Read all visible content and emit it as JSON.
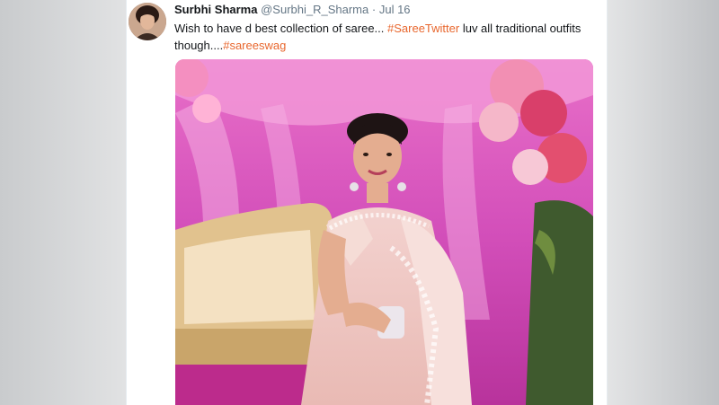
{
  "tweet": {
    "display_name": "Surbhi Sharma",
    "handle": "@Surbhi_R_Sharma",
    "separator": "·",
    "date": "Jul 16",
    "text_part1": "Wish to have d best collection of saree... ",
    "hashtag1": "#SareeTwitter",
    "text_part2": "  luv all traditional outfits though....",
    "hashtag2": "#sareeswag"
  },
  "colors": {
    "hashtag": "#e8672e",
    "text": "#14171a",
    "muted": "#657786"
  },
  "icons": {
    "avatar": "profile-photo",
    "media": "photo-woman-in-pink-saree"
  }
}
